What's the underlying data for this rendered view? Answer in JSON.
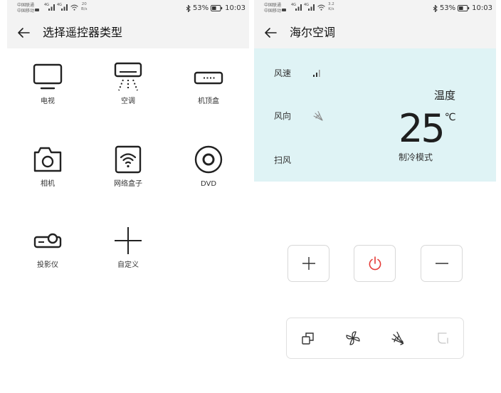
{
  "left_screen": {
    "status_bar": {
      "carrier_1": "中国联通",
      "carrier_2": "中国移动",
      "network_type": "4G",
      "net_speed_value": "20",
      "net_speed_unit": "B/s",
      "battery_percent": "53%",
      "battery_level": 0.53,
      "time": "10:03"
    },
    "header": {
      "back_icon": "back-arrow-icon",
      "title": "选择遥控器类型"
    },
    "device_types": [
      {
        "label": "电视",
        "icon": "tv-icon"
      },
      {
        "label": "空调",
        "icon": "air-conditioner-icon"
      },
      {
        "label": "机顶盒",
        "icon": "set-top-box-icon"
      },
      {
        "label": "相机",
        "icon": "camera-icon"
      },
      {
        "label": "网络盒子",
        "icon": "network-box-icon"
      },
      {
        "label": "DVD",
        "icon": "dvd-icon"
      },
      {
        "label": "投影仪",
        "icon": "projector-icon"
      },
      {
        "label": "自定义",
        "icon": "plus-icon"
      }
    ]
  },
  "right_screen": {
    "status_bar": {
      "carrier_1": "中国联通",
      "carrier_2": "中国移动",
      "network_type": "4G",
      "net_speed_value": "3.2",
      "net_speed_unit": "K/s",
      "battery_percent": "53%",
      "battery_level": 0.53,
      "time": "10:03"
    },
    "header": {
      "back_icon": "back-arrow-icon",
      "title": "海尔空调"
    },
    "status_panel": {
      "fan_speed_label": "风速",
      "fan_speed_icon": "fan-speed-bars-icon",
      "wind_direction_label": "风向",
      "wind_direction_icon": "wind-direction-icon",
      "sweep_label": "扫风",
      "temperature_label": "温度",
      "temperature_value": "25",
      "temperature_unit": "℃",
      "mode": "制冷模式"
    },
    "control_buttons": [
      {
        "icon": "plus-icon"
      },
      {
        "icon": "power-icon"
      },
      {
        "icon": "minus-icon"
      }
    ],
    "function_bar": [
      {
        "icon": "mode-icon"
      },
      {
        "icon": "fan-icon"
      },
      {
        "icon": "swing-icon"
      },
      {
        "icon": "sweep-icon",
        "disabled": true
      }
    ]
  },
  "colors": {
    "header_bg": "#f3f3f3",
    "panel_bg": "#dff3f5",
    "power_red": "#e53935",
    "icon_stroke": "#222222",
    "disabled_icon": "#c6c6c6",
    "label_text": "#333333"
  }
}
